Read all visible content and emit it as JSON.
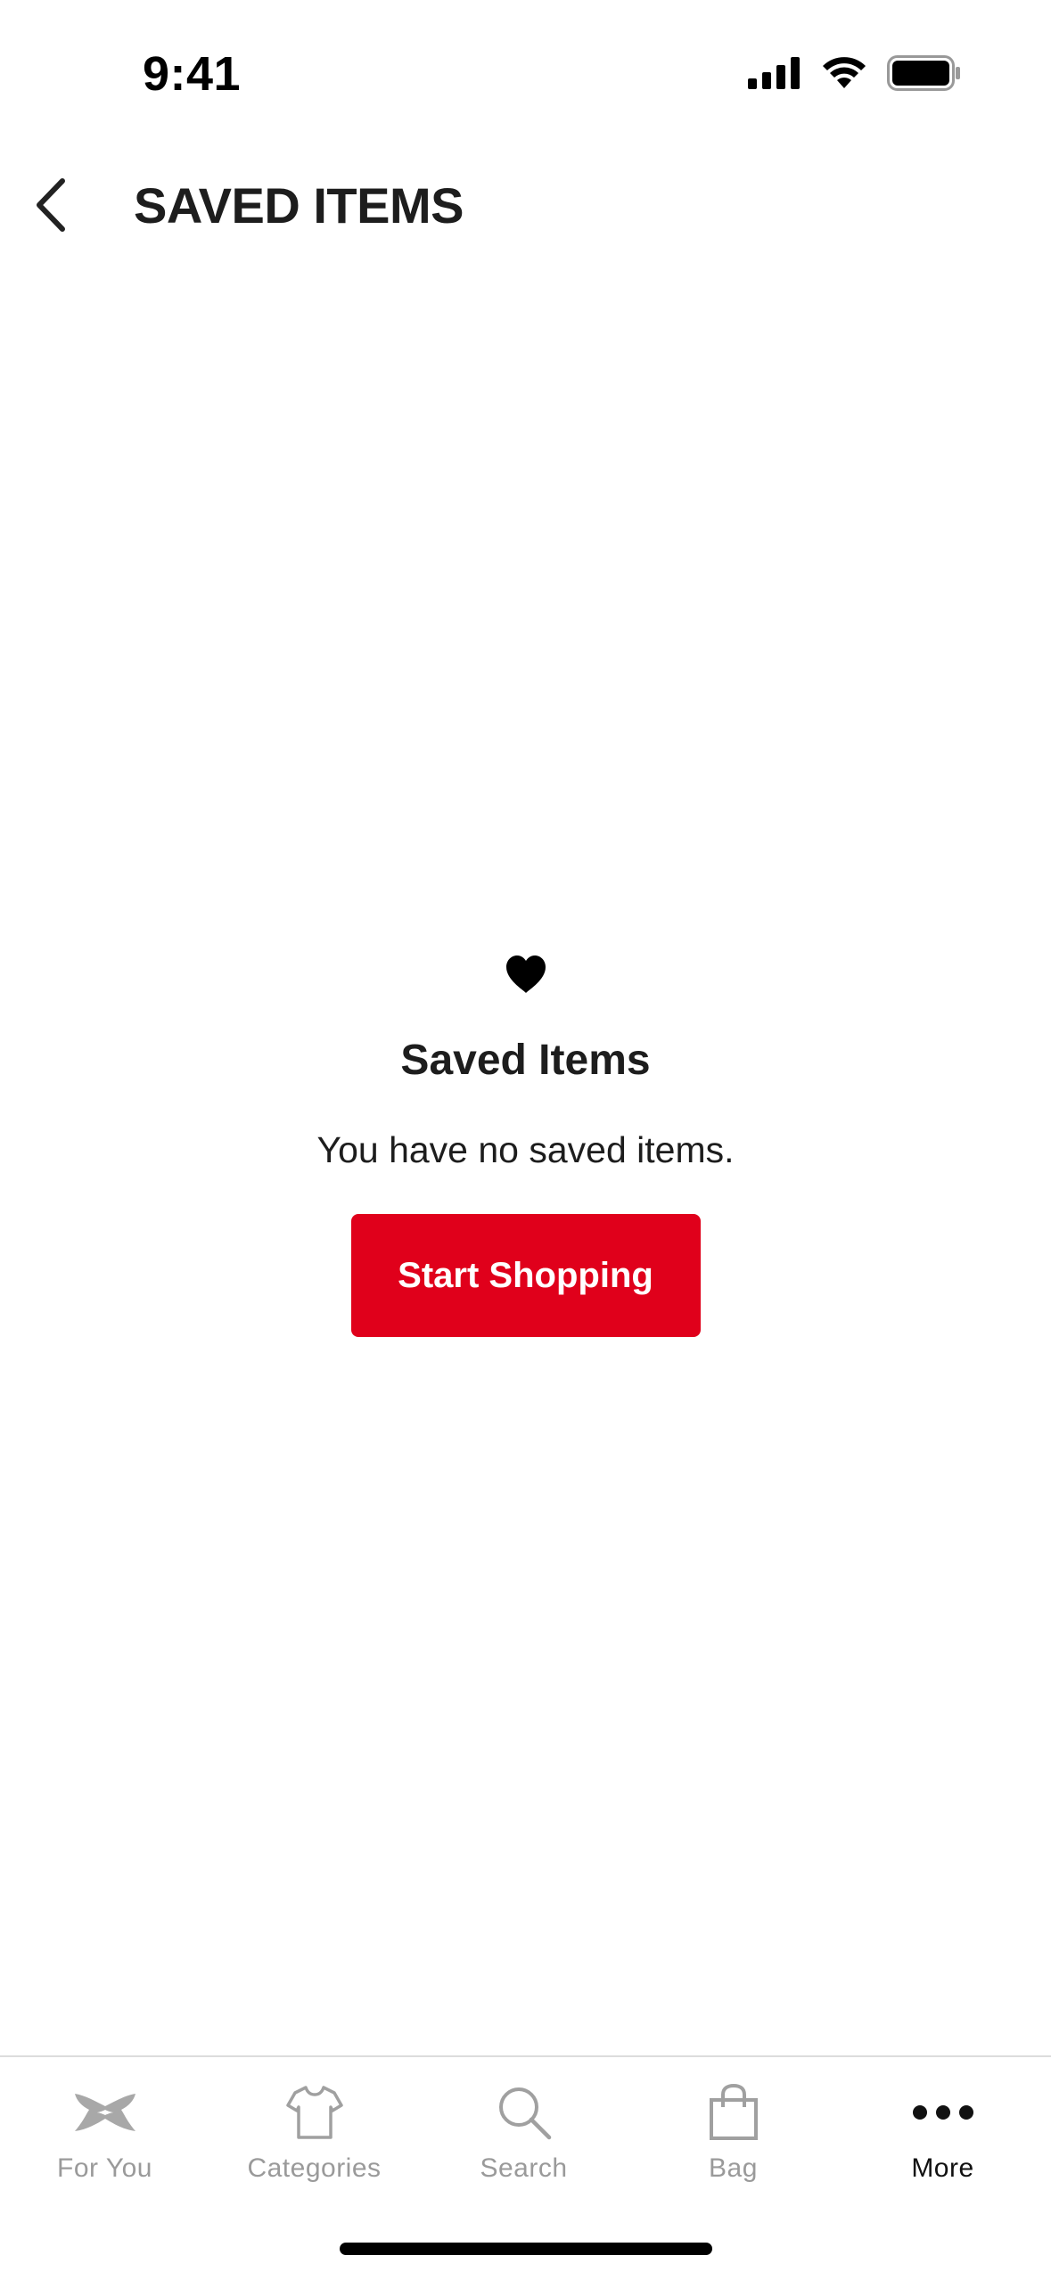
{
  "status_bar": {
    "time": "9:41"
  },
  "header": {
    "title": "SAVED ITEMS"
  },
  "empty_state": {
    "title": "Saved Items",
    "message": "You have no saved items.",
    "button_label": "Start Shopping"
  },
  "tab_bar": {
    "items": [
      {
        "label": "For You",
        "icon": "brand-logo-icon"
      },
      {
        "label": "Categories",
        "icon": "shirt-icon"
      },
      {
        "label": "Search",
        "icon": "search-icon"
      },
      {
        "label": "Bag",
        "icon": "bag-icon"
      },
      {
        "label": "More",
        "icon": "more-dots-icon",
        "active": true
      }
    ]
  },
  "colors": {
    "accent": "#e0001b",
    "inactive_tab": "#9a9a9a",
    "text": "#1d1d1d"
  }
}
